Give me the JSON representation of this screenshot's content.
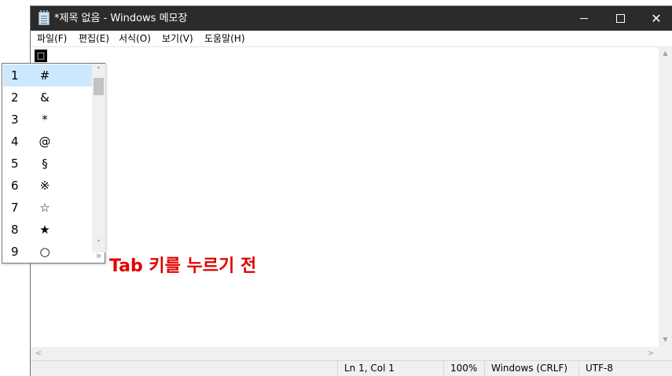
{
  "window": {
    "title": "*제목 없음 - Windows 메모장",
    "close_glyph": "✕"
  },
  "menu": {
    "file": "파일(F)",
    "edit": "편집(E)",
    "format": "서식(O)",
    "view": "보기(V)",
    "help": "도움말(H)"
  },
  "editor": {
    "cursor_glyph": "□"
  },
  "overlay": {
    "text": "Tab 키를 누르기 전",
    "color": "#e00000"
  },
  "candidates": {
    "selected_index": 1,
    "items": [
      {
        "num": "1",
        "symbol": "#"
      },
      {
        "num": "2",
        "symbol": "&"
      },
      {
        "num": "3",
        "symbol": "*"
      },
      {
        "num": "4",
        "symbol": "@"
      },
      {
        "num": "5",
        "symbol": "§"
      },
      {
        "num": "6",
        "symbol": "※"
      },
      {
        "num": "7",
        "symbol": "☆"
      },
      {
        "num": "8",
        "symbol": "★"
      },
      {
        "num": "9",
        "symbol": "○"
      }
    ],
    "scroll_up_glyph": "˄",
    "scroll_down_glyph": "˅",
    "more_glyph": "»",
    "highlight_color": "#cce8ff"
  },
  "scroll": {
    "up_glyph": "▲",
    "down_glyph": "▼",
    "left_glyph": "<",
    "right_glyph": ">"
  },
  "status": {
    "position": "Ln 1, Col 1",
    "zoom": "100%",
    "line_ending": "Windows (CRLF)",
    "encoding": "UTF-8"
  }
}
